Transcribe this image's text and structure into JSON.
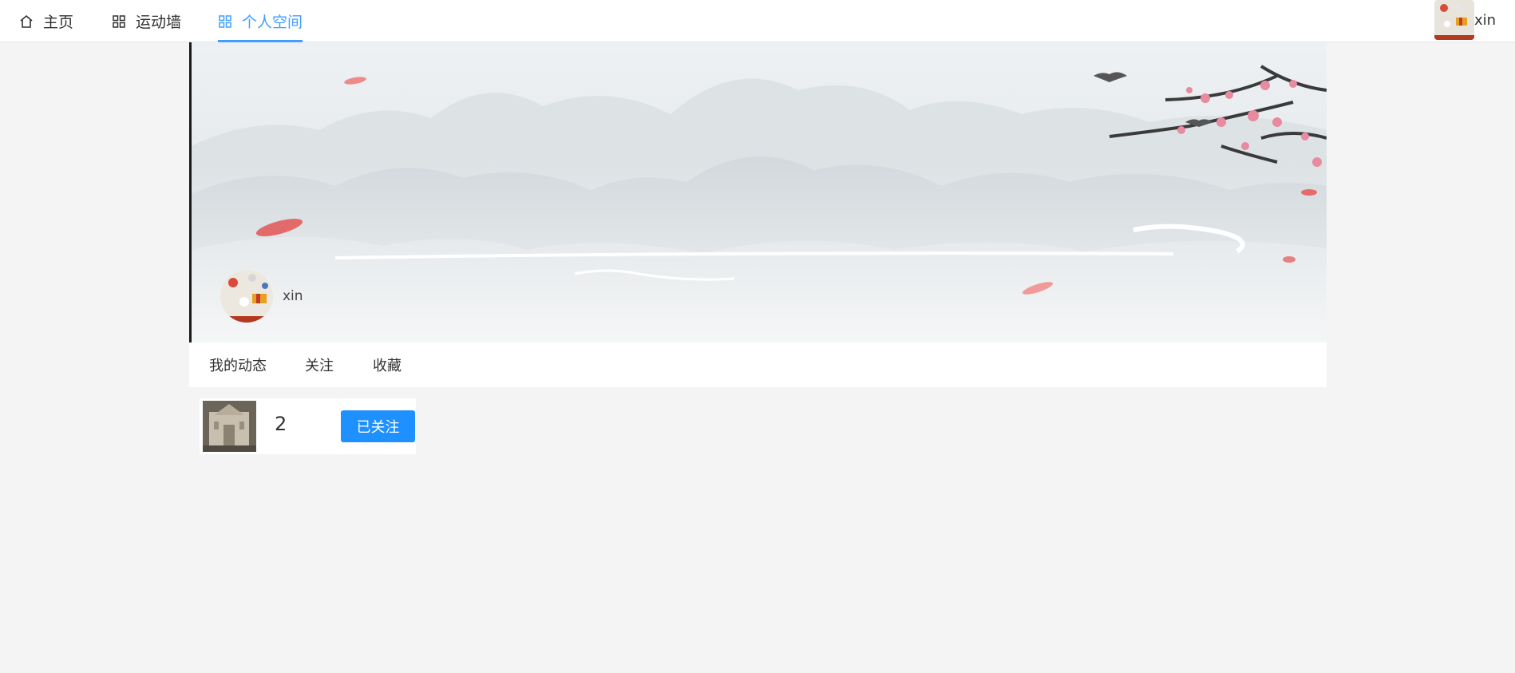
{
  "nav": {
    "items": [
      {
        "label": "主页",
        "icon": "home-icon"
      },
      {
        "label": "运动墙",
        "icon": "grid-icon"
      },
      {
        "label": "个人空间",
        "icon": "grid-icon",
        "active": true
      }
    ],
    "user_name": "xin"
  },
  "profile": {
    "user_name": "xin"
  },
  "tabs": [
    {
      "label": "我的动态"
    },
    {
      "label": "关注"
    },
    {
      "label": "收藏"
    }
  ],
  "following": {
    "count": "2",
    "button_label": "已关注"
  },
  "colors": {
    "accent": "#409eff",
    "button": "#1e90ff",
    "background": "#f4f4f4"
  }
}
